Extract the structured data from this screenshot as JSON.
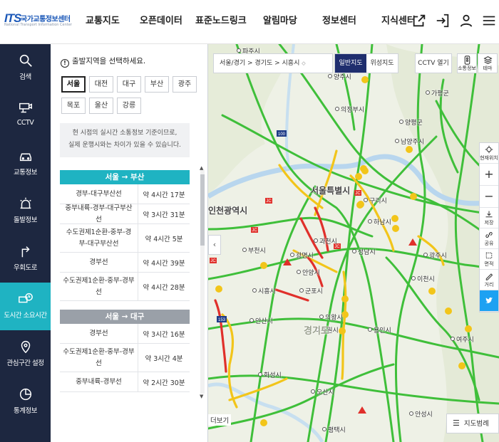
{
  "header": {
    "logo_mark": "ITS",
    "logo_title": "국가교통정보센터",
    "logo_sub": "National Transport Information Center",
    "nav": [
      "교통지도",
      "오픈데이터",
      "표준노드링크",
      "알림마당",
      "정보센터",
      "지식센터"
    ],
    "icons": [
      "external-link-icon",
      "login-icon",
      "user-icon",
      "menu-icon"
    ]
  },
  "rail": [
    {
      "label": "검색",
      "icon": "search-icon"
    },
    {
      "label": "CCTV",
      "icon": "cctv-icon"
    },
    {
      "label": "교통정보",
      "icon": "car-icon"
    },
    {
      "label": "돌발정보",
      "icon": "alert-icon"
    },
    {
      "label": "우회도로",
      "icon": "detour-icon"
    },
    {
      "label": "도시간 소요시간",
      "icon": "travel-time-icon",
      "active": true
    },
    {
      "label": "관심구간 설정",
      "icon": "pin-icon"
    },
    {
      "label": "통계정보",
      "icon": "stats-icon"
    }
  ],
  "panel": {
    "notice": "출발지역을 선택하세요.",
    "cities": [
      "서울",
      "대전",
      "대구",
      "부산",
      "광주",
      "목포",
      "울산",
      "강릉"
    ],
    "selected_city": "서울",
    "info_line1": "현 시점의 실시간 소통정보 기준이므로,",
    "info_line2": "실제 운행시와는 차이가 있을 수 있습니다.",
    "groups": [
      {
        "title": "서울 → 부산",
        "rows": [
          {
            "route": "경부-대구부산선",
            "time": "약 4시간 17분"
          },
          {
            "route": "중부내륙-경부-대구부산선",
            "time": "약 3시간 31분"
          },
          {
            "route": "수도권제1순환-중부-경부-대구부산선",
            "time": "약 4시간 5분"
          },
          {
            "route": "경부선",
            "time": "약 4시간 39분"
          },
          {
            "route": "수도권제1순환-중부-경부선",
            "time": "약 4시간 28분"
          }
        ]
      },
      {
        "title": "서울 → 대구",
        "rows": [
          {
            "route": "경부선",
            "time": "약 3시간 16분"
          },
          {
            "route": "수도권제1순환-중부-경부선",
            "time": "약 3시간 4분"
          },
          {
            "route": "중부내륙-경부선",
            "time": "약 2시간 30분"
          }
        ]
      }
    ]
  },
  "map": {
    "breadcrumb": "서울/경기 > 경기도 > 시흥시",
    "map_types": [
      "일반지도",
      "위성지도"
    ],
    "selected_map_type": "일반지도",
    "cctv_button": "CCTV 열기",
    "top_buttons": [
      {
        "label": "소통정보",
        "icon": "traffic-icon"
      },
      {
        "label": "테마",
        "icon": "layers-icon"
      }
    ],
    "tools": [
      {
        "label": "현재위치",
        "icon": "locate-icon"
      },
      {
        "label": "+",
        "icon": "zoom-in-icon"
      },
      {
        "label": "−",
        "icon": "zoom-out-icon"
      },
      {
        "label": "저장",
        "icon": "download-icon"
      },
      {
        "label": "공유",
        "icon": "share-icon"
      },
      {
        "label": "면적",
        "icon": "area-icon"
      },
      {
        "label": "거리",
        "icon": "ruler-icon"
      },
      {
        "label": "",
        "icon": "twitter-icon"
      }
    ],
    "more_link": "더보기",
    "legend_button": "지도범례",
    "places": [
      {
        "name": "파주시"
      },
      {
        "name": "양주시"
      },
      {
        "name": "의정부시"
      },
      {
        "name": "남양주시"
      },
      {
        "name": "서울특별시"
      },
      {
        "name": "인천광역시"
      },
      {
        "name": "부천시"
      },
      {
        "name": "광명시"
      },
      {
        "name": "과천시"
      },
      {
        "name": "성남시"
      },
      {
        "name": "하남시"
      },
      {
        "name": "안양시"
      },
      {
        "name": "군포시"
      },
      {
        "name": "시흥시"
      },
      {
        "name": "안산시"
      },
      {
        "name": "의왕시"
      },
      {
        "name": "수원시"
      },
      {
        "name": "용인시"
      },
      {
        "name": "화성시"
      },
      {
        "name": "오산시"
      },
      {
        "name": "평택시"
      },
      {
        "name": "광주시"
      },
      {
        "name": "구리시"
      },
      {
        "name": "양평군"
      },
      {
        "name": "가평군"
      },
      {
        "name": "이천시"
      },
      {
        "name": "여주시"
      },
      {
        "name": "안성시"
      },
      {
        "name": "경기도"
      }
    ]
  },
  "colors": {
    "rail_bg": "#1d2740",
    "rail_active": "#1fb3c2",
    "route_head": "#1fb3c2",
    "route_head_gray": "#9aa0a8",
    "map_type_active": "#1f2e6e",
    "road_green": "#3fbf3a",
    "road_yellow": "#f2c51a",
    "road_red": "#e0302b"
  }
}
